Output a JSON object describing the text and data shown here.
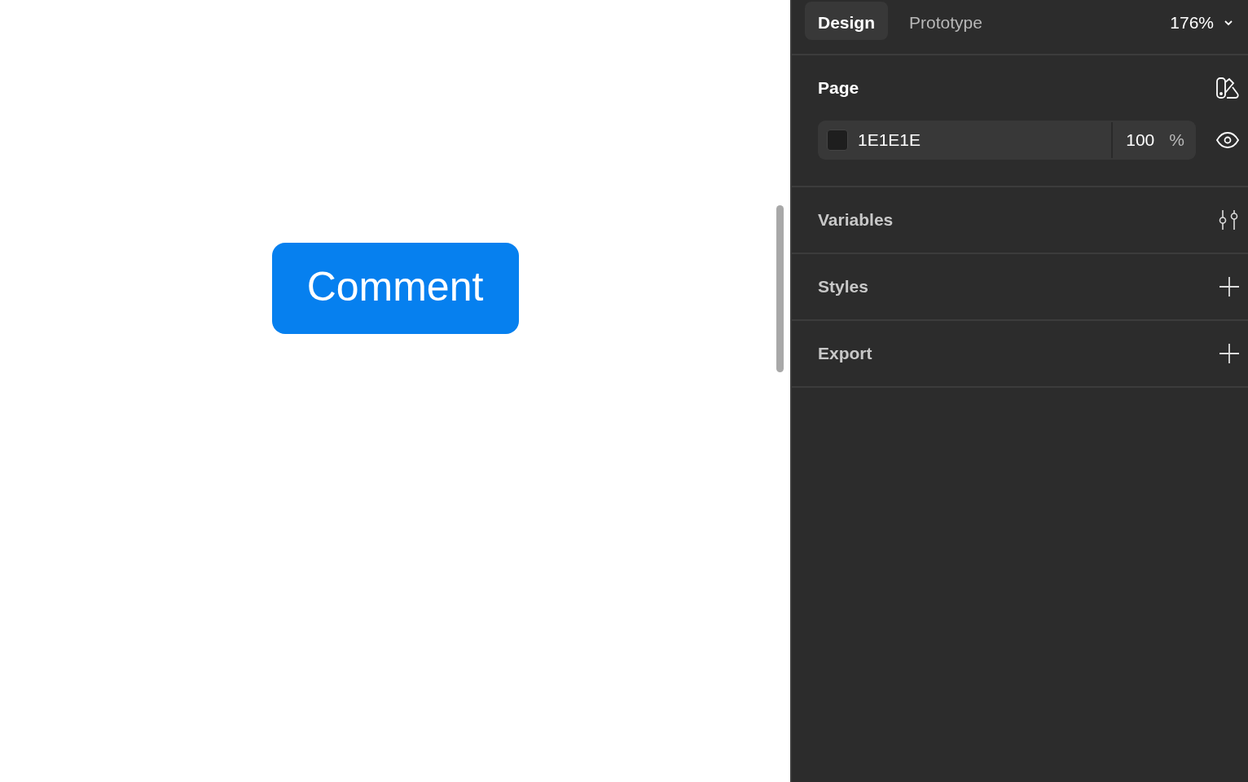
{
  "canvas": {
    "button": {
      "label": "Comment"
    }
  },
  "panel": {
    "tabs": [
      {
        "label": "Design",
        "selected": true
      },
      {
        "label": "Prototype",
        "selected": false
      }
    ],
    "zoom": "176%",
    "page": {
      "title": "Page",
      "fill": {
        "hex": "1E1E1E",
        "opacity": "100",
        "unit": "%"
      }
    },
    "sections": [
      {
        "title": "Variables",
        "kind": "adjust"
      },
      {
        "title": "Styles",
        "kind": "add"
      },
      {
        "title": "Export",
        "kind": "add"
      }
    ]
  }
}
